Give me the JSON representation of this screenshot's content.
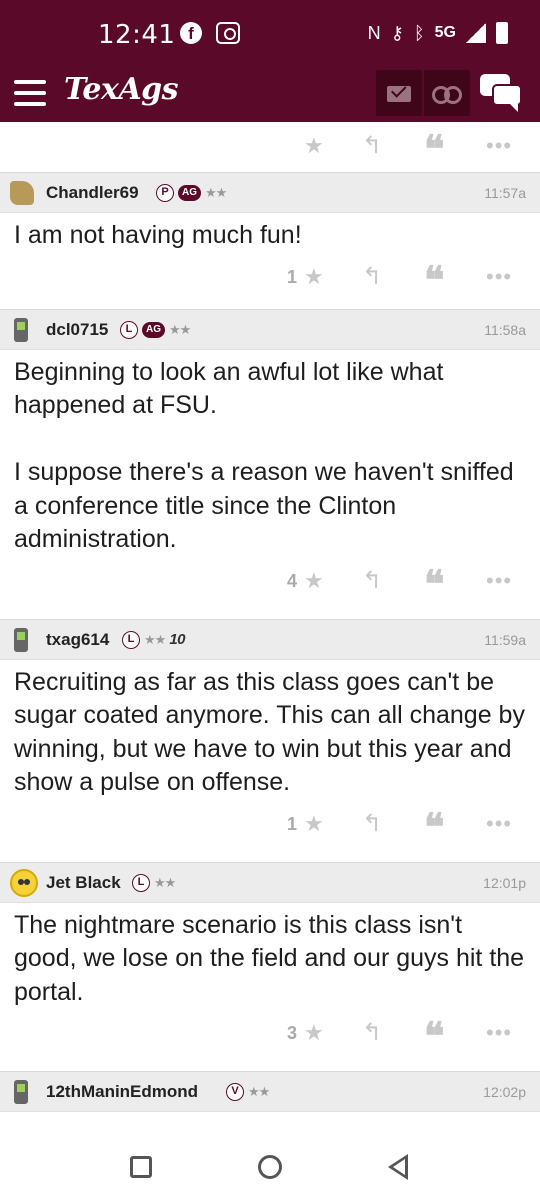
{
  "status_bar": {
    "time": "12:41",
    "network": "5G"
  },
  "app": {
    "title": "TexAgs"
  },
  "top_actions": {
    "star": "★",
    "reply": "↰",
    "quote": "❝",
    "more": "•••"
  },
  "posts": [
    {
      "username": "Chandler69",
      "badges": [
        "P",
        "AG",
        "★★"
      ],
      "time": "11:57a",
      "body": "I am not having much fun!",
      "likes": "1"
    },
    {
      "username": "dcl0715",
      "badges": [
        "L",
        "AG",
        "★★"
      ],
      "time": "11:58a",
      "body": "Beginning to look an awful lot like what happened at FSU.\n\nI suppose there's a reason we haven't sniffed a conference title since the Clinton administration.",
      "likes": "4"
    },
    {
      "username": "txag614",
      "badges": [
        "L",
        "★★",
        "10"
      ],
      "time": "11:59a",
      "body": "Recruiting as far as this class goes can't be sugar coated anymore. This can all change by winning, but we have to win but this year and show a pulse on offense.",
      "likes": "1"
    },
    {
      "username": "Jet Black",
      "badges": [
        "L",
        "★★"
      ],
      "time": "12:01p",
      "body": "The nightmare scenario is this class isn't good, we lose on the field and our guys hit the portal.",
      "likes": "3"
    },
    {
      "username": "12thManinEdmond",
      "badges": [
        "V",
        "★★"
      ],
      "time": "12:02p"
    }
  ],
  "icons": {
    "star": "★",
    "reply": "↰",
    "quote": "❝",
    "more": "•••"
  }
}
